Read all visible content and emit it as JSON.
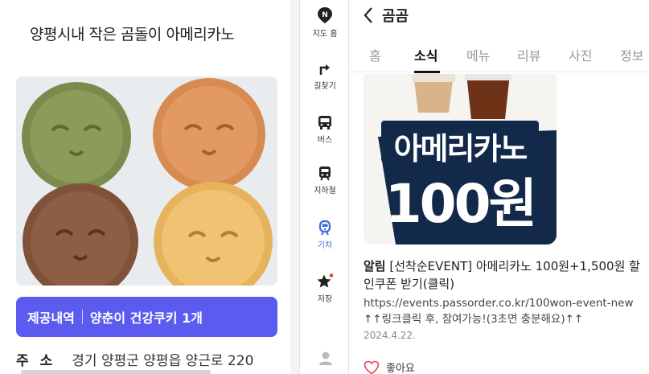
{
  "left": {
    "store_title": "양평시내 작은 곰돌이 아메리카노",
    "info_label": "제공내역",
    "info_value": "양춘이 건강쿠키 1개",
    "address_label": "주소",
    "address_value": "경기 양평군 양평읍 양근로 220"
  },
  "nav": {
    "items": [
      {
        "label": "지도 홈",
        "icon": "naver-map-icon"
      },
      {
        "label": "길찾기",
        "icon": "directions-icon"
      },
      {
        "label": "버스",
        "icon": "bus-icon"
      },
      {
        "label": "지하철",
        "icon": "subway-icon"
      },
      {
        "label": "기차",
        "icon": "train-icon",
        "active": true
      },
      {
        "label": "저장",
        "icon": "star-icon"
      }
    ],
    "active_color": "#3a6de0"
  },
  "place": {
    "name": "곰곰",
    "tabs": [
      "홈",
      "소식",
      "메뉴",
      "리뷰",
      "사진",
      "정보"
    ],
    "active_tab": "소식"
  },
  "post": {
    "promo_line1": "아메리카노",
    "promo_line2": "100원",
    "title_bold": "알림",
    "title_text": "[선착순EVENT] 아메리카노 100원+1,500원 할인쿠폰 받기(클릭)",
    "link_text": "https://events.passorder.co.kr/100won-event-new ↑↑링크클릭 후, 참여가능!(3초면 충분해요)↑↑",
    "date": "2024.4.22.",
    "like_label": "좋아요"
  },
  "colors": {
    "accent_purple": "#5c5bf0",
    "promo_navy": "#12294a"
  }
}
